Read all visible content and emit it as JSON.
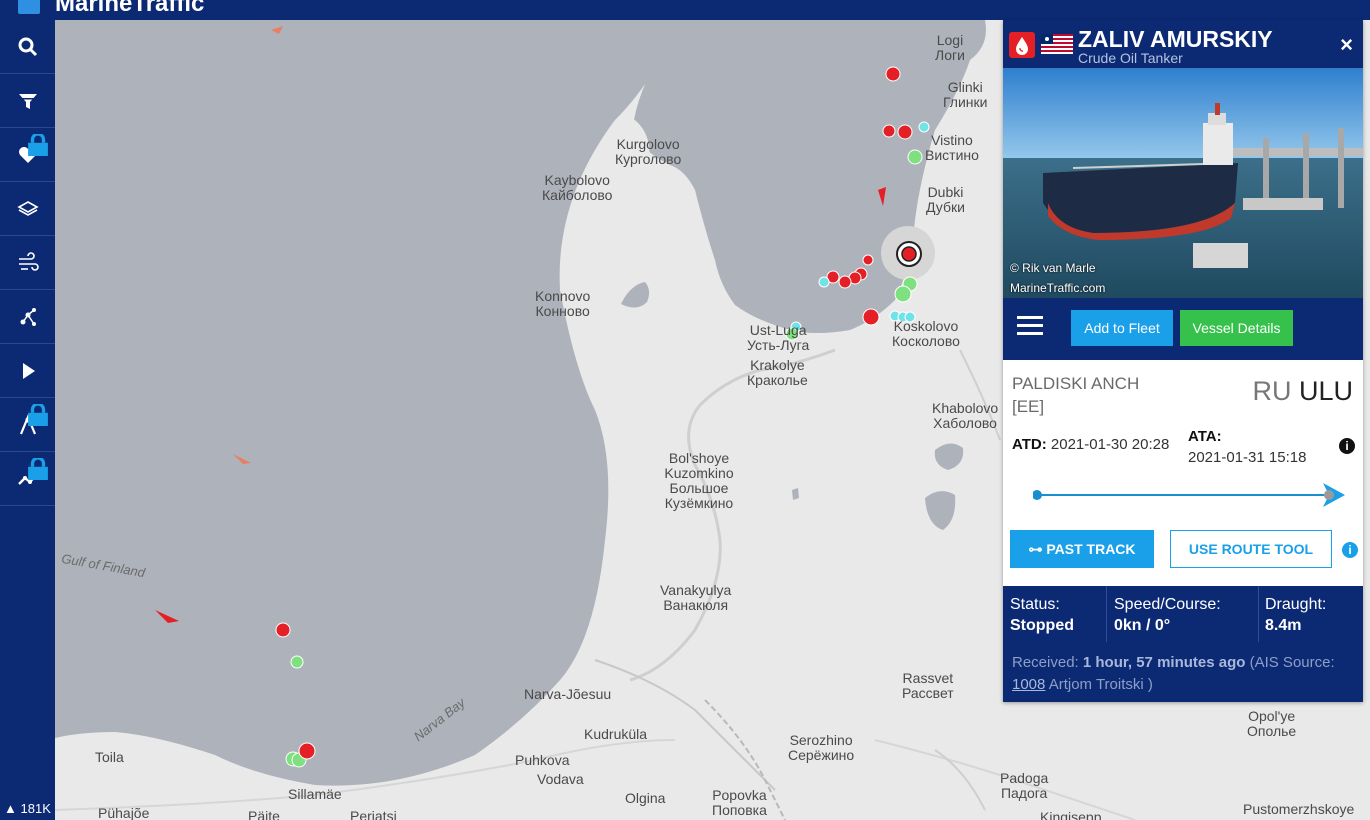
{
  "app": {
    "logo_text": "MarineTraffic"
  },
  "sidebar": {
    "items": [
      {
        "name": "search-icon",
        "locked": false
      },
      {
        "name": "filter-icon",
        "locked": false
      },
      {
        "name": "heart-icon",
        "locked": true
      },
      {
        "name": "layers-icon",
        "locked": false
      },
      {
        "name": "wind-icon",
        "locked": false
      },
      {
        "name": "measure-icon",
        "locked": false
      },
      {
        "name": "play-icon",
        "locked": false
      },
      {
        "name": "route-icon",
        "locked": true
      },
      {
        "name": "chart-line-icon",
        "locked": true
      }
    ],
    "vessel_count": "181K"
  },
  "map": {
    "places": [
      {
        "en": "Logi",
        "ru": "Логи"
      },
      {
        "en": "Glinki",
        "ru": "Глинки"
      },
      {
        "en": "Kurgolovo",
        "ru": "Курголово"
      },
      {
        "en": "Vistino",
        "ru": "Вистино"
      },
      {
        "en": "Kaybolovo",
        "ru": "Кайболово"
      },
      {
        "en": "Dubki",
        "ru": "Дубки"
      },
      {
        "en": "Konnovo",
        "ru": "Конново"
      },
      {
        "en": "Ust-Luga",
        "ru": "Усть-Луга"
      },
      {
        "en": "Koskolovo",
        "ru": "Косколово"
      },
      {
        "en": "Krakolye",
        "ru": "Краколье"
      },
      {
        "en": "Khabolovo",
        "ru": "Хаболово"
      },
      {
        "en": "Bol'shoye Kuzomkino",
        "ru": "Большое Кузёмкино"
      },
      {
        "en": "Vanakyulya",
        "ru": "Ванакюля"
      },
      {
        "en": "Rassvet",
        "ru": "Рассвет"
      },
      {
        "en": "Narva-Jõesuu",
        "ru": ""
      },
      {
        "en": "Kudruküla",
        "ru": ""
      },
      {
        "en": "Serozhino",
        "ru": "Серёжино"
      },
      {
        "en": "Toila",
        "ru": ""
      },
      {
        "en": "Puhkova",
        "ru": ""
      },
      {
        "en": "Vodava",
        "ru": ""
      },
      {
        "en": "Olgina",
        "ru": ""
      },
      {
        "en": "Popovka",
        "ru": "Поповка"
      },
      {
        "en": "Sillamäe",
        "ru": ""
      },
      {
        "en": "Padoga",
        "ru": "Падога"
      },
      {
        "en": "Opol'ye",
        "ru": "Ополье"
      },
      {
        "en": "Pühajõe",
        "ru": ""
      },
      {
        "en": "Päite",
        "ru": ""
      },
      {
        "en": "Perjatsi",
        "ru": ""
      },
      {
        "en": "Kingisepp",
        "ru": ""
      },
      {
        "en": "Pustomerzhskoye",
        "ru": ""
      }
    ],
    "water_labels": [
      "Gulf of Finland",
      "Narva Bay"
    ]
  },
  "vessel": {
    "name": "ZALIV AMURSKIY",
    "type": "Crude Oil Tanker",
    "flag": "Liberia",
    "photo_credit_1": "© Rik van Marle",
    "photo_credit_2": "MarineTraffic.com",
    "close_label": "×",
    "add_fleet": "Add to Fleet",
    "vessel_details": "Vessel Details",
    "from_port": "PALDISKI ANCH",
    "from_country": "[EE]",
    "to_country": "RU",
    "to_port": "ULU",
    "atd_label": "ATD:",
    "atd": "2021-01-30 20:28",
    "ata_label": "ATA:",
    "ata": "2021-01-31 15:18",
    "past_track": "PAST TRACK",
    "route_tool": "USE ROUTE TOOL",
    "status_label": "Status:",
    "status": "Stopped",
    "speed_label": "Speed/Course:",
    "speed": "0kn / 0°",
    "draught_label": "Draught:",
    "draught": "8.4m",
    "received_label": "Received:",
    "received": "1 hour, 57 minutes ago",
    "ais_label": "(AIS Source:",
    "ais_id": "1008",
    "ais_name": "Artjom Troitski )"
  },
  "colors": {
    "navy": "#0c2a74",
    "sea": "#aeb2bb",
    "land": "#e9e9e9",
    "accent_blue": "#1aa0e8",
    "accent_green": "#35c14b",
    "tanker_red": "#e42026"
  }
}
